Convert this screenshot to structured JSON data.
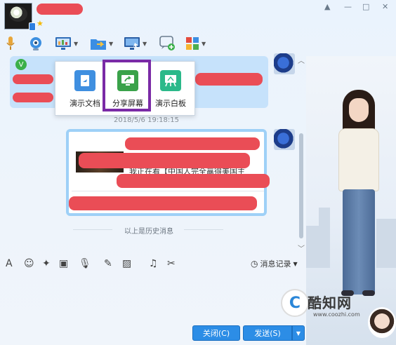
{
  "header": {
    "star": "★",
    "window_controls": [
      "▲",
      "—",
      "□",
      "✕"
    ]
  },
  "toolbar": {
    "items": [
      {
        "icon": "microphone-icon"
      },
      {
        "icon": "video-camera-icon"
      },
      {
        "icon": "screen-share-icon"
      },
      {
        "icon": "file-transfer-icon"
      },
      {
        "icon": "remote-desktop-icon"
      },
      {
        "icon": "create-group-icon"
      },
      {
        "icon": "apps-icon"
      }
    ]
  },
  "popup": {
    "items": [
      {
        "label": "演示文档",
        "icon": "present-document-icon",
        "color": "#3f8fe0"
      },
      {
        "label": "分享屏幕",
        "icon": "share-screen-icon",
        "color": "#3aa24a"
      },
      {
        "label": "演示白板",
        "icon": "whiteboard-icon",
        "color": "#2bb98a"
      }
    ]
  },
  "chat": {
    "timestamp": "2018/5/6 19:18:15",
    "card_text": "我正在看【中国人完全赢得美国主",
    "history_label": "以上是历史消息"
  },
  "bottom_toolbar": {
    "history_record": "消息记录"
  },
  "buttons": {
    "close": "关闭(C)",
    "send": "发送(S)"
  },
  "watermark": {
    "brand": "酷知网",
    "url": "www.coozhi.com"
  },
  "colors": {
    "accent": "#2c8de6",
    "highlight": "#7a2aa6",
    "redaction": "#ea4d56",
    "bubble": "#c6e2fb"
  }
}
